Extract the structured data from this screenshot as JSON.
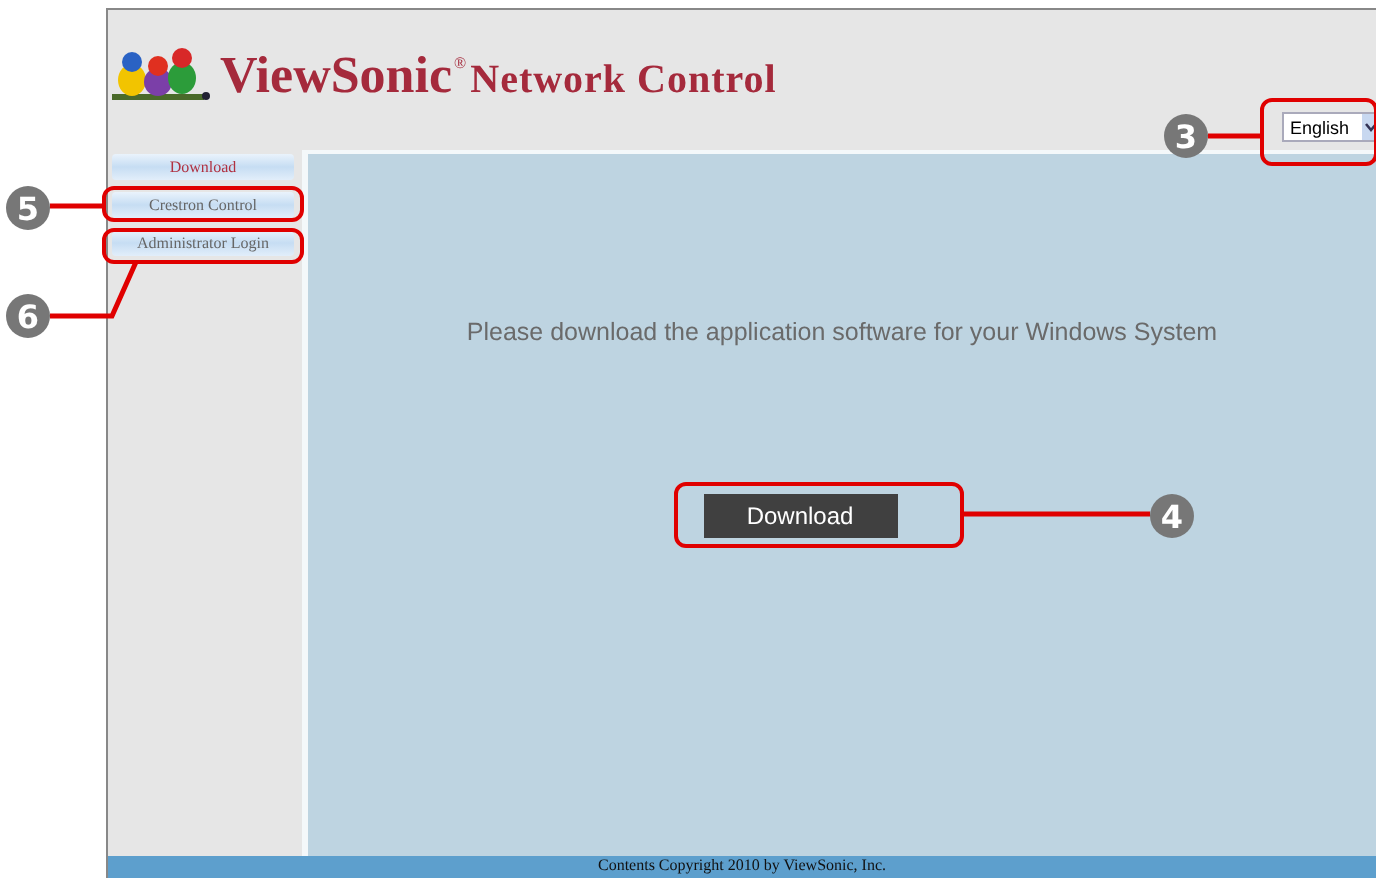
{
  "header": {
    "brand": "ViewSonic",
    "registered_mark": "®",
    "product": "Network Control",
    "language_select": {
      "value": "English"
    }
  },
  "sidebar": {
    "items": [
      {
        "label": "Download",
        "selected": true
      },
      {
        "label": "Crestron Control",
        "selected": false
      },
      {
        "label": "Administrator Login",
        "selected": false
      }
    ]
  },
  "content": {
    "message": "Please download the application software for your Windows System",
    "button": "Download"
  },
  "footer": {
    "text": "Contents Copyright 2010 by ViewSonic, Inc."
  },
  "callouts": [
    {
      "number": "3",
      "kind": "language"
    },
    {
      "number": "4",
      "kind": "download"
    },
    {
      "number": "5",
      "kind": "crestron"
    },
    {
      "number": "6",
      "kind": "admin"
    }
  ]
}
